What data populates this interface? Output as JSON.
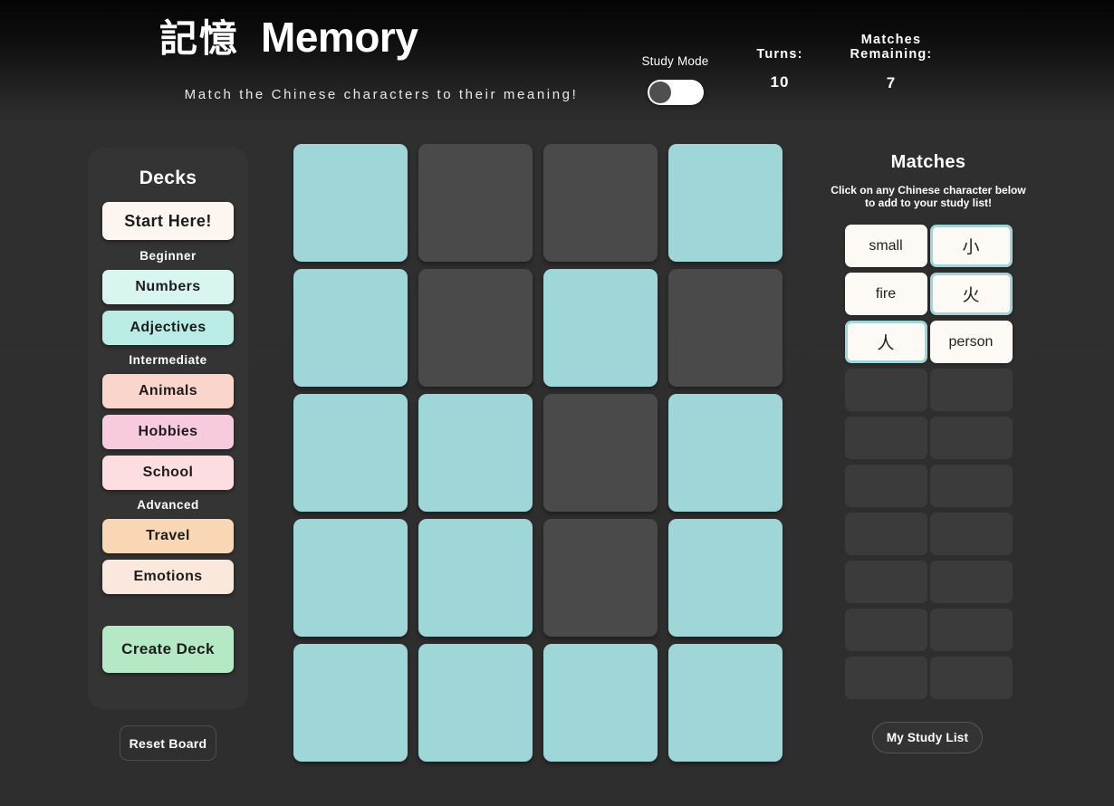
{
  "header": {
    "title_cn": "記憶",
    "title_en": "Memory",
    "subtitle": "Match the Chinese characters to their meaning!",
    "study_mode_label": "Study Mode",
    "study_mode_on": false,
    "turns_label": "Turns:",
    "turns_value": "10",
    "matches_remaining_label": "Matches\nRemaining:",
    "matches_remaining_label_line1": "Matches",
    "matches_remaining_label_line2": "Remaining:",
    "matches_remaining_value": "7"
  },
  "sidebar": {
    "title": "Decks",
    "start_label": "Start Here!",
    "groups": [
      {
        "label": "Beginner",
        "decks": [
          {
            "label": "Numbers",
            "color": "#d9f5f0"
          },
          {
            "label": "Adjectives",
            "color": "#b8ece5"
          }
        ]
      },
      {
        "label": "Intermediate",
        "decks": [
          {
            "label": "Animals",
            "color": "#fad5cb"
          },
          {
            "label": "Hobbies",
            "color": "#f7cade"
          },
          {
            "label": "School",
            "color": "#fbdde2"
          }
        ]
      },
      {
        "label": "Advanced",
        "decks": [
          {
            "label": "Travel",
            "color": "#f9d7b5"
          },
          {
            "label": "Emotions",
            "color": "#fbe8dd"
          }
        ]
      }
    ],
    "create_deck_label": "Create Deck",
    "create_deck_color": "#b5e8c4",
    "start_color": "#fdf6f0",
    "reset_board_label": "Reset Board"
  },
  "board": {
    "rows": 5,
    "columns": 4,
    "face_down_color": "#4a4a4a",
    "matched_color": "#9fd6d8",
    "cells": [
      [
        "matched",
        "down",
        "down",
        "matched"
      ],
      [
        "matched",
        "down",
        "matched",
        "down"
      ],
      [
        "matched",
        "matched",
        "down",
        "matched"
      ],
      [
        "matched",
        "matched",
        "down",
        "matched"
      ],
      [
        "matched",
        "matched",
        "matched",
        "matched"
      ]
    ]
  },
  "matches": {
    "title": "Matches",
    "hint_line1": "Click on any Chinese character below",
    "hint_line2": "to add to your study list!",
    "accent_color": "#9fd6d8",
    "pairs": [
      {
        "left": "small",
        "left_type": "meaning",
        "right": "小",
        "right_type": "chinese"
      },
      {
        "left": "fire",
        "left_type": "meaning",
        "right": "火",
        "right_type": "chinese"
      },
      {
        "left": "人",
        "left_type": "chinese",
        "right": "person",
        "right_type": "meaning"
      }
    ],
    "empty_rows": 7,
    "study_list_button": "My Study List"
  }
}
